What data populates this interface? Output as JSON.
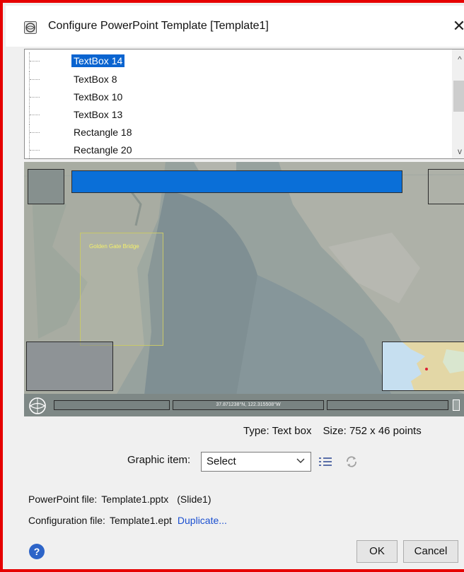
{
  "window": {
    "title": "Configure PowerPoint Template [Template1]",
    "close_glyph": "✕"
  },
  "tree": {
    "items": [
      {
        "label": "TextBox 14",
        "selected": true
      },
      {
        "label": "TextBox 8",
        "selected": false
      },
      {
        "label": "TextBox 10",
        "selected": false
      },
      {
        "label": "TextBox 13",
        "selected": false
      },
      {
        "label": "Rectangle 18",
        "selected": false
      },
      {
        "label": "Rectangle 20",
        "selected": false
      }
    ]
  },
  "preview": {
    "map_label": "Golden Gate Bridge",
    "coordinates": "37.871238°N, 122.315508°W"
  },
  "info": {
    "type_text": "Type: Text box",
    "size_text": "Size: 752 x 46 points"
  },
  "graphic": {
    "label": "Graphic item:",
    "select_value": "Select"
  },
  "files": {
    "pptx_label": "PowerPoint file:",
    "pptx_value": "Template1.pptx",
    "pptx_slide": "(Slide1)",
    "config_label": "Configuration file:",
    "config_value": "Template1.ept",
    "duplicate_link": "Duplicate..."
  },
  "buttons": {
    "ok": "OK",
    "cancel": "Cancel",
    "help_glyph": "?"
  },
  "colors": {
    "selection": "#0a64d0",
    "frame_border": "#e60000",
    "link": "#1a4fd0"
  }
}
